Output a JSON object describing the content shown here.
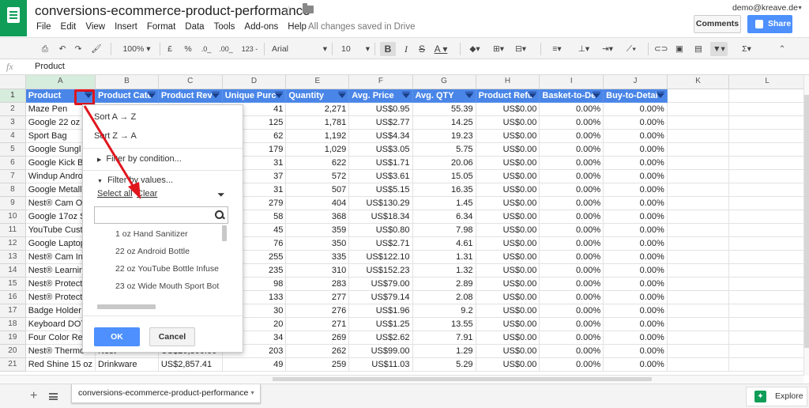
{
  "app": {
    "doc_title": "conversions-ecommerce-product-performance",
    "save_status": "All changes saved in Drive",
    "user_email": "demo@kreave.de",
    "menu": [
      "File",
      "Edit",
      "View",
      "Insert",
      "Format",
      "Data",
      "Tools",
      "Add-ons",
      "Help"
    ],
    "comments_label": "Comments",
    "share_label": "Share",
    "accent_color": "#4a86e8",
    "brand_color": "#0f9d58"
  },
  "toolbar": {
    "zoom": "100%",
    "currency": "£",
    "percent": "%",
    "dec_less": ".0_",
    "dec_more": ".00_",
    "format_more": "123 -",
    "font": "Arial",
    "font_size": "10",
    "bold": "B",
    "italic": "I",
    "strike": "S",
    "text_color": "A"
  },
  "formula_bar": {
    "fx": "fx",
    "value": "Product"
  },
  "grid": {
    "col_letters": [
      "A",
      "B",
      "C",
      "D",
      "E",
      "F",
      "G",
      "H",
      "I",
      "J",
      "K",
      "L"
    ],
    "headers": [
      "Product",
      "Product Cate",
      "Product Rev",
      "Unique Purc",
      "Quantity",
      "Avg. Price",
      "Avg. QTY",
      "Product Refu",
      "Basket-to-De",
      "Buy-to-Detai"
    ],
    "rows": [
      {
        "n": "2",
        "cells": [
          "Maze Pen",
          "",
          "",
          "41",
          "2,271",
          "US$0.95",
          "55.39",
          "US$0.00",
          "0.00%",
          "0.00%"
        ]
      },
      {
        "n": "3",
        "cells": [
          "Google 22 oz",
          "",
          "",
          "125",
          "1,781",
          "US$2.77",
          "14.25",
          "US$0.00",
          "0.00%",
          "0.00%"
        ]
      },
      {
        "n": "4",
        "cells": [
          "Sport Bag",
          "",
          "",
          "62",
          "1,192",
          "US$4.34",
          "19.23",
          "US$0.00",
          "0.00%",
          "0.00%"
        ]
      },
      {
        "n": "5",
        "cells": [
          "Google Sungl",
          "",
          "",
          "179",
          "1,029",
          "US$3.05",
          "5.75",
          "US$0.00",
          "0.00%",
          "0.00%"
        ]
      },
      {
        "n": "6",
        "cells": [
          "Google Kick B",
          "",
          "",
          "31",
          "622",
          "US$1.71",
          "20.06",
          "US$0.00",
          "0.00%",
          "0.00%"
        ]
      },
      {
        "n": "7",
        "cells": [
          "Windup Andro",
          "",
          "",
          "37",
          "572",
          "US$3.61",
          "15.05",
          "US$0.00",
          "0.00%",
          "0.00%"
        ]
      },
      {
        "n": "8",
        "cells": [
          "Google Metall",
          "",
          "",
          "31",
          "507",
          "US$5.15",
          "16.35",
          "US$0.00",
          "0.00%",
          "0.00%"
        ]
      },
      {
        "n": "9",
        "cells": [
          "Nest® Cam O",
          "",
          "",
          "279",
          "404",
          "US$130.29",
          "1.45",
          "US$0.00",
          "0.00%",
          "0.00%"
        ]
      },
      {
        "n": "10",
        "cells": [
          "Google 17oz S",
          "",
          "",
          "58",
          "368",
          "US$18.34",
          "6.34",
          "US$0.00",
          "0.00%",
          "0.00%"
        ]
      },
      {
        "n": "11",
        "cells": [
          "YouTube Cust",
          "",
          "",
          "45",
          "359",
          "US$0.80",
          "7.98",
          "US$0.00",
          "0.00%",
          "0.00%"
        ]
      },
      {
        "n": "12",
        "cells": [
          "Google Laptop",
          "",
          "",
          "76",
          "350",
          "US$2.71",
          "4.61",
          "US$0.00",
          "0.00%",
          "0.00%"
        ]
      },
      {
        "n": "13",
        "cells": [
          "Nest® Cam In",
          "",
          "",
          "255",
          "335",
          "US$122.10",
          "1.31",
          "US$0.00",
          "0.00%",
          "0.00%"
        ]
      },
      {
        "n": "14",
        "cells": [
          "Nest® Learnin",
          "",
          "",
          "235",
          "310",
          "US$152.23",
          "1.32",
          "US$0.00",
          "0.00%",
          "0.00%"
        ]
      },
      {
        "n": "15",
        "cells": [
          "Nest® Protect",
          "",
          "",
          "98",
          "283",
          "US$79.00",
          "2.89",
          "US$0.00",
          "0.00%",
          "0.00%"
        ]
      },
      {
        "n": "16",
        "cells": [
          "Nest® Protect",
          "",
          "",
          "133",
          "277",
          "US$79.14",
          "2.08",
          "US$0.00",
          "0.00%",
          "0.00%"
        ]
      },
      {
        "n": "17",
        "cells": [
          "Badge Holder",
          "",
          "",
          "30",
          "276",
          "US$1.96",
          "9.2",
          "US$0.00",
          "0.00%",
          "0.00%"
        ]
      },
      {
        "n": "18",
        "cells": [
          "Keyboard DOT",
          "",
          "",
          "20",
          "271",
          "US$1.25",
          "13.55",
          "US$0.00",
          "0.00%",
          "0.00%"
        ]
      },
      {
        "n": "19",
        "cells": [
          "Four Color Re",
          "",
          "",
          "34",
          "269",
          "US$2.62",
          "7.91",
          "US$0.00",
          "0.00%",
          "0.00%"
        ]
      },
      {
        "n": "20",
        "cells": [
          "Nest® Thermo",
          "Nest",
          "US$20,300.00",
          "203",
          "262",
          "US$99.00",
          "1.29",
          "US$0.00",
          "0.00%",
          "0.00%"
        ]
      },
      {
        "n": "21",
        "cells": [
          "Red Shine 15 oz",
          "Drinkware",
          "US$2,857.41",
          "49",
          "259",
          "US$11.03",
          "5.29",
          "US$0.00",
          "0.00%",
          "0.00%"
        ]
      }
    ]
  },
  "filter_menu": {
    "sort_az": "Sort A → Z",
    "sort_za": "Sort Z → A",
    "filter_by_condition": "Filter by condition...",
    "filter_by_values": "Filter by values...",
    "select_all": "Select all",
    "clear": "Clear",
    "search_placeholder": "",
    "values": [
      "1 oz Hand Sanitizer",
      "22 oz Android Bottle",
      "22 oz YouTube Bottle Infuse",
      "23 oz Wide Mouth Sport Bot"
    ],
    "ok_label": "OK",
    "cancel_label": "Cancel"
  },
  "sheetbar": {
    "sheet_tab": "conversions-ecommerce-product-performance",
    "explore_label": "Explore"
  }
}
